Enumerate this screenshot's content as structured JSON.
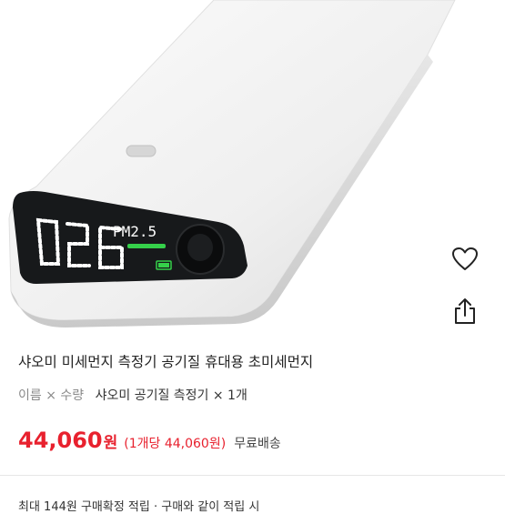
{
  "product": {
    "title": "샤오미 미세먼지 측정기 공기질 휴대용 초미세먼지",
    "image_alt": "Xiaomi portable air quality monitor",
    "device_display": {
      "reading": "026",
      "label": "PM2.5"
    }
  },
  "actions": {
    "like_icon": "heart-icon",
    "share_icon": "share-icon"
  },
  "option": {
    "key": "이름 × 수량",
    "value": "샤오미 공기질 측정기 × 1개"
  },
  "price": {
    "amount": "44,060",
    "unit": "원",
    "per_unit": "(1개당 44,060원)",
    "shipping": "무료배송"
  },
  "promo": {
    "text": "최대 144원 구매확정 적립 · 구매와 같이 적립 시"
  },
  "colors": {
    "price": "#e8212e",
    "display_segment": "#ffffff",
    "display_bar": "#35d04a"
  }
}
